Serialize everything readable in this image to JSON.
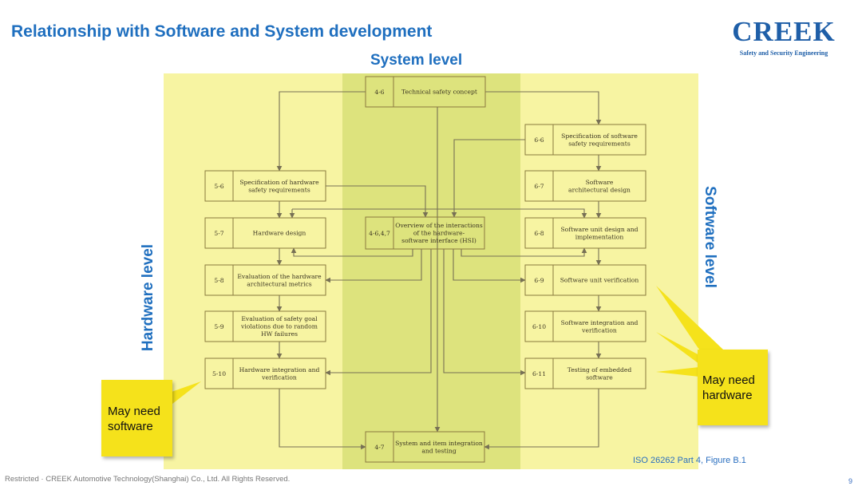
{
  "slide": {
    "title": "Relationship with Software and System development",
    "logo": {
      "word": "CREEK",
      "tagline": "Safety and Security Engineering"
    },
    "system_level_label": "System level",
    "hardware_level_label": "Hardware level",
    "software_level_label": "Software level",
    "callout_software": [
      "May need",
      "software"
    ],
    "callout_hardware": [
      "May need",
      "hardware"
    ],
    "source": "ISO 26262 Part 4, Figure B.1",
    "footer": "Restricted · CREEK Automotive Technology(Shanghai) Co., Ltd. All Rights Reserved.",
    "page_number": "9"
  },
  "colors": {
    "side_panel": "#f7f4a2",
    "center_panel": "#dde37d",
    "box_stroke": "#8a7a3e",
    "arrow": "#777055",
    "text_blue": "#1f6fbf",
    "callout": "#f5e21b"
  },
  "diagram": {
    "boxes": [
      {
        "id": "b46",
        "code": "4-6",
        "lines": [
          "Technical safety concept"
        ]
      },
      {
        "id": "b66",
        "code": "6-6",
        "lines": [
          "Specification of software",
          "safety requirements"
        ]
      },
      {
        "id": "b67",
        "code": "6-7",
        "lines": [
          "Software",
          "architectural design"
        ]
      },
      {
        "id": "b68",
        "code": "6-8",
        "lines": [
          "Software unit design and",
          "implementation"
        ]
      },
      {
        "id": "b69",
        "code": "6-9",
        "lines": [
          "Software unit verification"
        ]
      },
      {
        "id": "b610",
        "code": "6-10",
        "lines": [
          "Software integration and",
          "verification"
        ]
      },
      {
        "id": "b611",
        "code": "6-11",
        "lines": [
          "Testing of embedded",
          "software"
        ]
      },
      {
        "id": "b56",
        "code": "5-6",
        "lines": [
          "Specification of hardware",
          "safety requirements"
        ]
      },
      {
        "id": "b57",
        "code": "5-7",
        "lines": [
          "Hardware design"
        ]
      },
      {
        "id": "b58",
        "code": "5-8",
        "lines": [
          "Evaluation of the hardware",
          "architectural metrics"
        ]
      },
      {
        "id": "b59",
        "code": "5-9",
        "lines": [
          "Evaluation of safety goal",
          "violations due to random",
          "HW failures"
        ]
      },
      {
        "id": "b510",
        "code": "5-10",
        "lines": [
          "Hardware integration and",
          "verification"
        ]
      },
      {
        "id": "b4647",
        "code": "4-6,4,7",
        "lines": [
          "Overview of the interactions",
          "of the  hardware-",
          "software interface (HSI)"
        ]
      },
      {
        "id": "b47",
        "code": "4-7",
        "lines": [
          "System and item integration",
          "and testing"
        ]
      }
    ]
  }
}
